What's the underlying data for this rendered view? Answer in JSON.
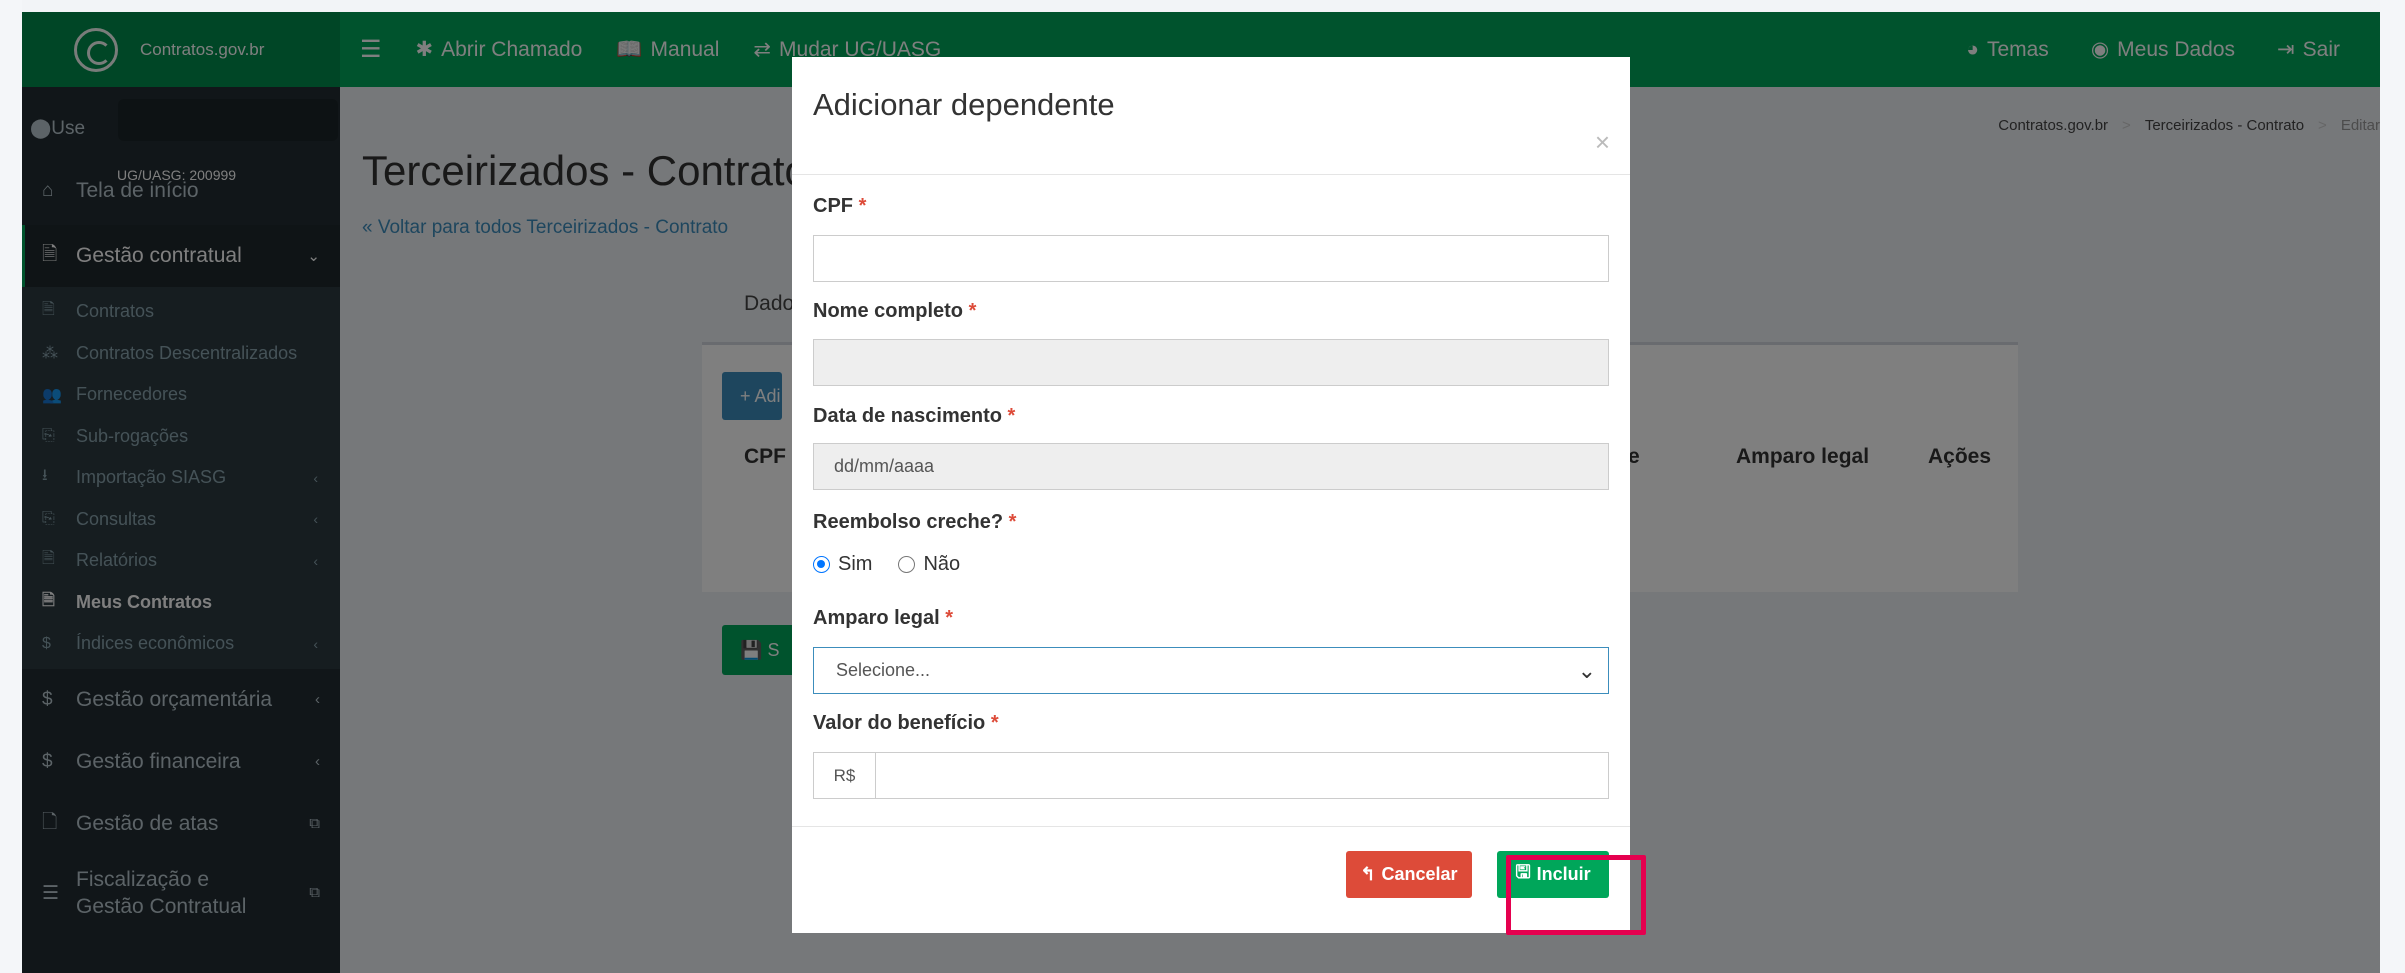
{
  "navbar": {
    "logo_text": "Contratos.gov.br",
    "abrir_chamado": "Abrir Chamado",
    "manual": "Manual",
    "mudar_ug": "Mudar UG/UASG",
    "temas": "Temas",
    "meus_dados": "Meus Dados",
    "sair": "Sair"
  },
  "sidebar": {
    "user_label": "Use",
    "ug": "UG/UASG: 200999",
    "tela_inicio": "Tela de início",
    "gestao_contratual": "Gestão contratual",
    "sub": [
      {
        "icon": "file-icon",
        "glyph": "🗎",
        "label": "Contratos",
        "chev": ""
      },
      {
        "icon": "sitemap-icon",
        "glyph": "⁂",
        "label": "Contratos Descentralizados",
        "chev": ""
      },
      {
        "icon": "users-icon",
        "glyph": "👥",
        "label": "Fornecedores",
        "chev": ""
      },
      {
        "icon": "copy-icon",
        "glyph": "⎘",
        "label": "Sub-rogações",
        "chev": ""
      },
      {
        "icon": "download-icon",
        "glyph": "⭳",
        "label": "Importação SIASG",
        "chev": "‹"
      },
      {
        "icon": "copy-icon",
        "glyph": "⎘",
        "label": "Consultas",
        "chev": "‹"
      },
      {
        "icon": "file-icon",
        "glyph": "🗎",
        "label": "Relatórios",
        "chev": "‹"
      },
      {
        "icon": "file-icon",
        "glyph": "🗎",
        "label": "Meus Contratos",
        "chev": ""
      },
      {
        "icon": "dollar-icon",
        "glyph": "$",
        "label": "Índices econômicos",
        "chev": "‹"
      }
    ],
    "gestao_orcamentaria": "Gestão orçamentária",
    "gestao_financeira": "Gestão financeira",
    "gestao_atas": "Gestão de atas",
    "fiscalizacao_1": "Fiscalização e",
    "fiscalizacao_2": "Gestão Contratual"
  },
  "content": {
    "breadcrumb": [
      "Contratos.gov.br",
      "Terceirizados - Contrato",
      "Editar"
    ],
    "page_title": "Terceirizados - Contrato",
    "back_link": "« Voltar para todos Terceirizados - Contrato",
    "tab_label": "Dado",
    "btn_add": "+ Adi",
    "col_cpf": "CPF",
    "col_e": "e",
    "col_amparo": "Amparo legal",
    "col_acoes": "Ações",
    "btn_save": "S"
  },
  "modal": {
    "title": "Adicionar dependente",
    "close": "×",
    "cpf_label": "CPF",
    "nome_label": "Nome completo",
    "data_label": "Data de nascimento",
    "data_placeholder": "dd/mm/aaaa",
    "reembolso_label": "Reembolso creche?",
    "sim": "Sim",
    "nao": "Não",
    "amparo_label": "Amparo legal",
    "amparo_value": "Selecione...",
    "valor_label": "Valor do benefício",
    "currency": "R$",
    "required_mark": "*",
    "cancel": "Cancelar",
    "incluir": "Incluir"
  },
  "colors": {
    "green": "#00a65a",
    "red": "#dd4b39",
    "highlight": "#e5004f",
    "sidebar": "#222d32"
  }
}
